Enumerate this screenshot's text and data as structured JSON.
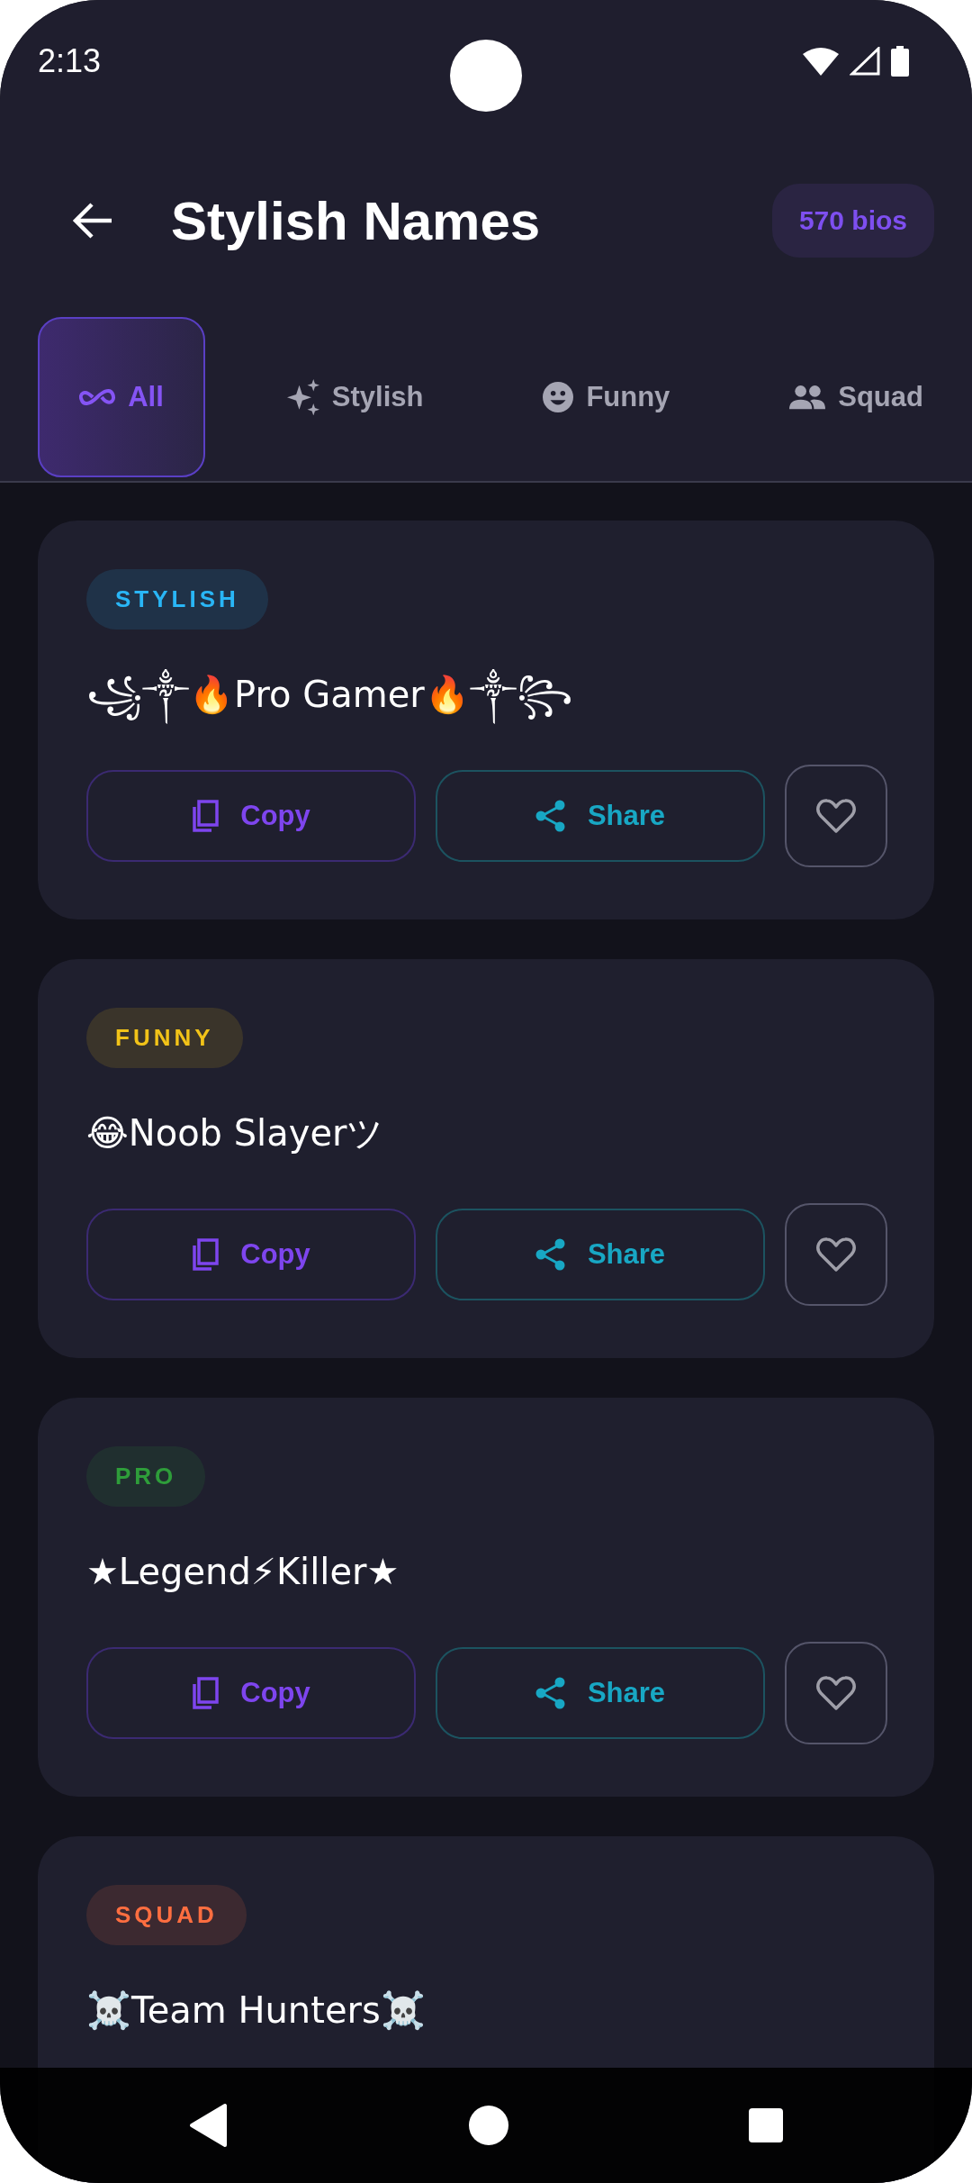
{
  "status_bar": {
    "time": "2:13"
  },
  "header": {
    "title": "Stylish Names",
    "count_badge": "570 bios"
  },
  "tabs": [
    {
      "label": "All",
      "selected": true
    },
    {
      "label": "Stylish",
      "selected": false
    },
    {
      "label": "Funny",
      "selected": false
    },
    {
      "label": "Squad",
      "selected": false
    }
  ],
  "cards": [
    {
      "tag": "STYLISH",
      "color": "#29b6f6",
      "name": "꧁༒🔥Pro Gamer🔥༒꧂",
      "copy_label": "Copy",
      "share_label": "Share",
      "favorite": false
    },
    {
      "tag": "FUNNY",
      "color": "#f2c318",
      "name": "😂Noob Slayerツ",
      "copy_label": "Copy",
      "share_label": "Share",
      "favorite": false
    },
    {
      "tag": "PRO",
      "color": "#2e9d3a",
      "name": "★Legend⚡Killer★",
      "copy_label": "Copy",
      "share_label": "Share",
      "favorite": false
    },
    {
      "tag": "SQUAD",
      "color": "#ff6e40",
      "name": "☠️Team Hunters☠️"
    }
  ]
}
